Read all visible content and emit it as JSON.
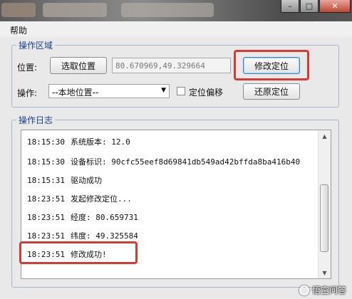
{
  "colors": {
    "accent": "#1a3f8c",
    "highlight_red": "#d63b35",
    "window_bg": "#e9e9e9"
  },
  "menu": {
    "help": "帮助"
  },
  "operation_group": {
    "title": "操作区域",
    "position_label": "位置:",
    "pick_button": "选取位置",
    "coordinates_value": "80.670969,49.329664",
    "modify_button": "修改定位",
    "operation_label": "操作:",
    "operation_selected": "--本地位置--",
    "offset_checkbox_label": "定位偏移",
    "offset_checked": false,
    "restore_button": "还原定位"
  },
  "log_group": {
    "title": "操作日志",
    "lines": [
      {
        "time": "18:15:30",
        "text": "系统版本: 12.0"
      },
      {
        "time": "18:15:30",
        "text": "设备标识: 90cfc55eef8d69841db549ad42bffda8ba416b40"
      },
      {
        "time": "18:15:31",
        "text": "驱动成功"
      },
      {
        "time": "18:23:51",
        "text": "发起修改定位..."
      },
      {
        "time": "18:23:51",
        "text": "经度: 80.659731"
      },
      {
        "time": "18:23:51",
        "text": "纬度: 49.325584"
      },
      {
        "time": "18:23:51",
        "text": "修改成功!"
      }
    ]
  },
  "icons": {
    "minimize": "minimize-icon",
    "maximize": "maximize-icon",
    "close": "close-icon",
    "dropdown": "chevron-down-icon",
    "scroll_up": "arrow-up-icon",
    "scroll_down": "arrow-down-icon"
  },
  "watermark": {
    "text": "悟空问答"
  }
}
